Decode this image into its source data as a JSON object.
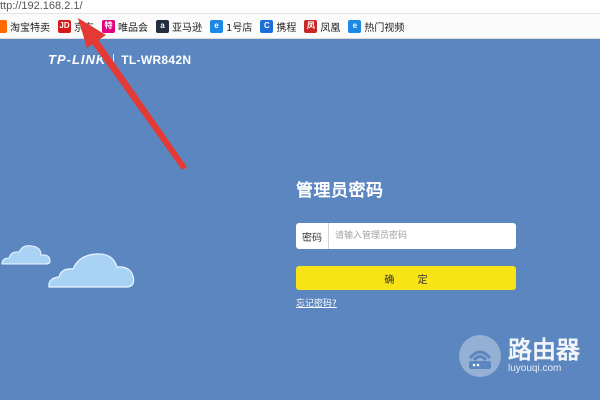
{
  "browser": {
    "url": "ttp://192.168.2.1/",
    "bookmarks": [
      {
        "label": "淘宝特卖",
        "icon": "taobao-icon",
        "icon_text": "",
        "color": "#ff6a00"
      },
      {
        "label": "京东",
        "icon": "jd-icon",
        "icon_text": "JD",
        "color": "#d71a1a"
      },
      {
        "label": "唯品会",
        "icon": "vip-icon",
        "icon_text": "特",
        "color": "#e4007f"
      },
      {
        "label": "亚马逊",
        "icon": "amazon-icon",
        "icon_text": "a",
        "color": "#232f3e"
      },
      {
        "label": "1号店",
        "icon": "ie-icon",
        "icon_text": "e",
        "color": "#1e88e5"
      },
      {
        "label": "携程",
        "icon": "ctrip-icon",
        "icon_text": "C",
        "color": "#1c6fd6"
      },
      {
        "label": "凤凰",
        "icon": "ifeng-icon",
        "icon_text": "凤",
        "color": "#c62828"
      },
      {
        "label": "热门视频",
        "icon": "ie-icon",
        "icon_text": "e",
        "color": "#1e88e5"
      }
    ]
  },
  "router": {
    "brand": "TP-LINK",
    "model": "TL-WR842N",
    "login_title": "管理员密码",
    "password_label": "密码",
    "password_placeholder": "请输入管理员密码",
    "password_value": "",
    "confirm_label": "确 定",
    "forgot_link": "忘记密码?"
  },
  "watermark": {
    "name": "路由器",
    "domain": "luyouqi.com"
  },
  "colors": {
    "background": "#5b86bf",
    "button": "#f8e317",
    "arrow": "#e53935",
    "cloud": "#a9d3f5"
  }
}
